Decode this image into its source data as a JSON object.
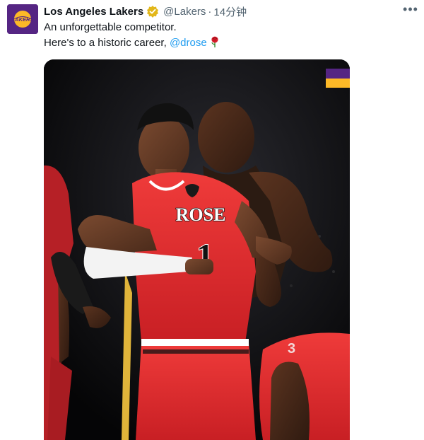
{
  "account": {
    "name": "Los Angeles Lakers",
    "handle": "@Lakers",
    "separator": "·",
    "time": "14分钟",
    "avatar_text": "LAKERS"
  },
  "tweet": {
    "line1": "An unforgettable competitor.",
    "line2_prefix": "Here's to a historic career, ",
    "mention": "@drose"
  },
  "media": {
    "jersey_name": "ROSE",
    "jersey_number": "1"
  },
  "icons": {
    "verified": "verified-badge-icon",
    "rose": "rose-emoji-icon",
    "more": "more-options-icon"
  },
  "colors": {
    "lakers_purple": "#552583",
    "lakers_gold": "#FDB927",
    "bulls_red": "#e3262f",
    "link_blue": "#1d9bf0"
  }
}
